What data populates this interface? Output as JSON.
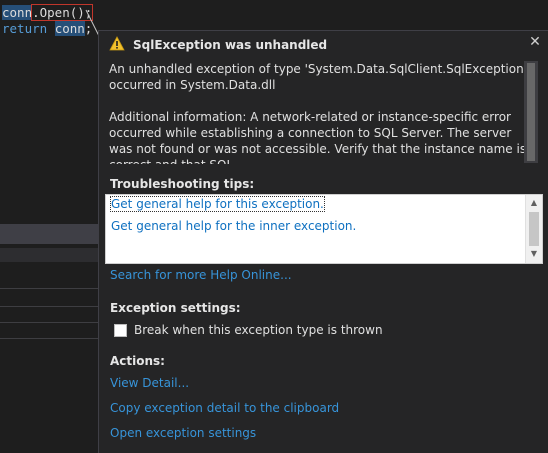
{
  "editor": {
    "line1_var": "conn",
    "line1_rest": ".Open();",
    "line2_kw": "return",
    "line2_var": "conn",
    "line2_end": ";"
  },
  "popup": {
    "warning_icon": "warning-icon",
    "title": "SqlException was unhandled",
    "close_glyph": "✕",
    "message_1": "An unhandled exception of type 'System.Data.SqlClient.SqlException' occurred in System.Data.dll",
    "message_2": "Additional information: A network-related or instance-specific error occurred while establishing a connection to SQL Server. The server was not found or was not accessible. Verify that the instance name is correct and that SQL",
    "tips_label": "Troubleshooting tips:",
    "tips": [
      "Get general help for this exception.",
      "Get general help for the inner exception."
    ],
    "search_link": "Search for more Help Online...",
    "exception_settings_label": "Exception settings:",
    "checkbox_label": "Break when this exception type is thrown",
    "checkbox_checked": false,
    "actions_label": "Actions:",
    "actions": [
      "View Detail...",
      "Copy exception detail to the clipboard",
      "Open exception settings"
    ]
  },
  "colors": {
    "background": "#1e1e1e",
    "popup_bg": "#252526",
    "link": "#3794d9",
    "warning": "#f2c12e",
    "error_outline": "#c1362b"
  }
}
